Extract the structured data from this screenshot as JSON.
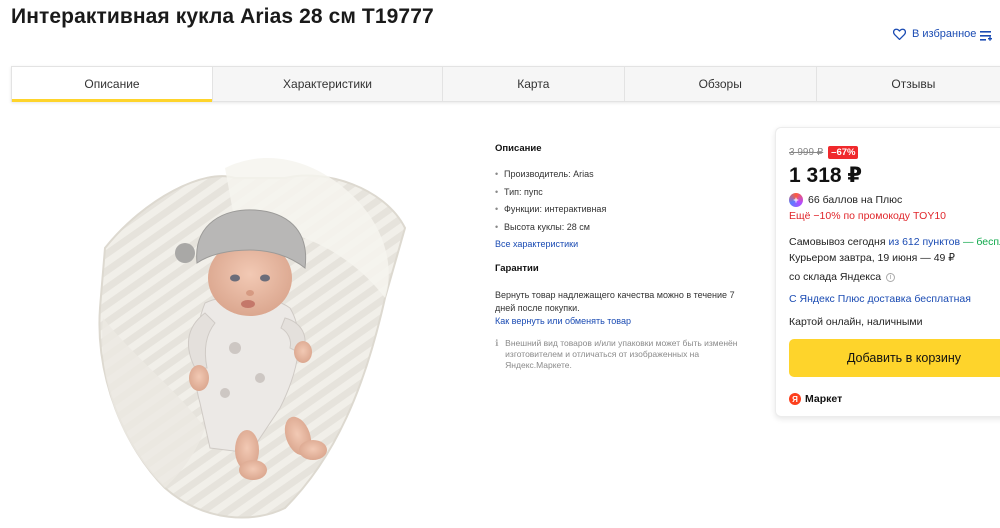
{
  "product": {
    "title": "Интерактивная кукла Arias 28 см T19777",
    "favorites_label": "В избранное"
  },
  "icons": {
    "favorite": "heart-icon",
    "compare": "compare-list-icon",
    "info": "info-icon",
    "plus": "yandex-plus-icon",
    "market": "yandex-market-logo-icon"
  },
  "tabs": [
    {
      "label": "Описание",
      "active": true
    },
    {
      "label": "Характеристики",
      "active": false
    },
    {
      "label": "Карта",
      "active": false
    },
    {
      "label": "Обзоры",
      "active": false
    },
    {
      "label": "Отзывы",
      "active": false
    }
  ],
  "description": {
    "heading": "Описание",
    "specs": [
      "Производитель: Arias",
      "Тип: пупс",
      "Функции: интерактивная",
      "Высота куклы: 28 см"
    ],
    "all_specs_link": "Все характеристики",
    "guarantee_heading": "Гарантии",
    "guarantee_text": "Вернуть товар надлежащего качества можно в течение 7 дней после покупки.",
    "return_link": "Как вернуть или обменять товар",
    "disclaimer": "Внешний вид товаров и/или упаковки может быть изменён изготовителем и отличаться от изображенных на Яндекс.Маркете."
  },
  "offer": {
    "old_price": "3 999 ₽",
    "discount": "–67%",
    "price": "1 318 ₽",
    "plus_points": "66 баллов на Плюс",
    "promo": "Ещё −10% по промокоду TOY10",
    "pickup_prefix": "Самовывоз сегодня ",
    "pickup_points": "из 612 пунктов",
    "pickup_suffix": " — беспла",
    "courier": "Курьером завтра, 19 июня — 49 ₽",
    "warehouse": "со склада Яндекса",
    "plus_delivery": "С Яндекс Плюс доставка бесплатная",
    "payment": "Картой онлайн, наличными",
    "cart_button": "Добавить в корзину",
    "seller": "Маркет",
    "seller_logo_letter": "Я",
    "colors": {
      "accent": "#fed42b",
      "discount": "#f0292c",
      "link": "#1a4bb3",
      "green": "#10a84b"
    }
  }
}
